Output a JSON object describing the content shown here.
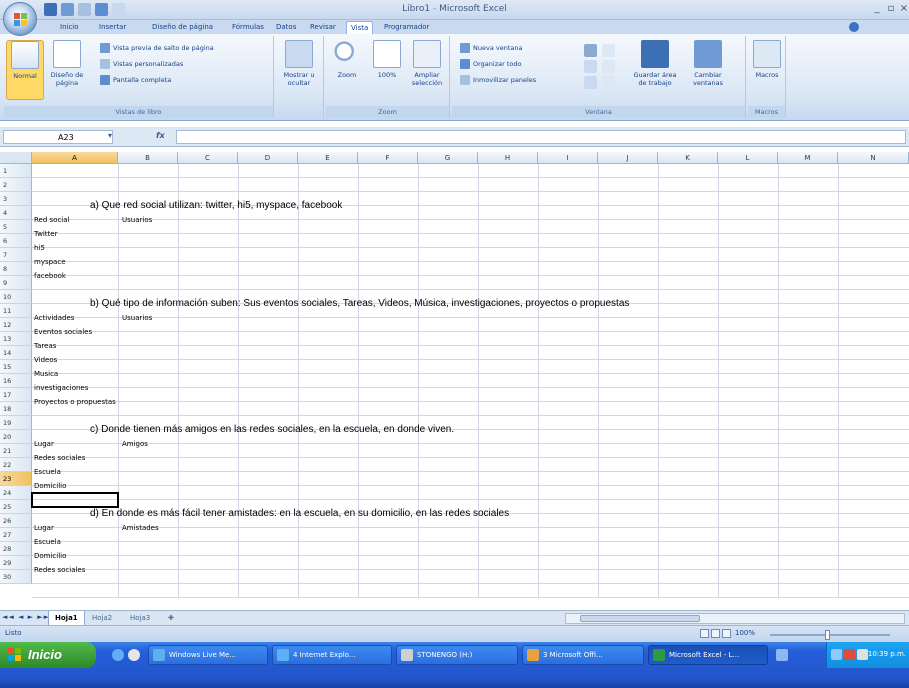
{
  "window": {
    "title_doc": "Libro1",
    "title_sep": "-",
    "title_app": "Microsoft Excel"
  },
  "ribbon_tabs": [
    "Inicio",
    "Insertar",
    "Diseño de página",
    "Fórmulas",
    "Datos",
    "Revisar",
    "Vista",
    "Programador"
  ],
  "active_tab": "Vista",
  "ribbon": {
    "vistas_libro": {
      "label": "Vistas de libro",
      "normal": "Normal",
      "diseno_pagina": "Diseño de página",
      "vista_previa": "Vista previa de salto de página",
      "vistas_personalizadas": "Vistas personalizadas",
      "pantalla_completa": "Pantalla completa"
    },
    "mostrar": {
      "label": "Mostrar u ocultar"
    },
    "zoom": {
      "label": "Zoom",
      "zoom": "Zoom",
      "cien": "100%",
      "ampliar": "Ampliar selección"
    },
    "ventana": {
      "label": "Ventana",
      "nueva": "Nueva ventana",
      "organizar": "Organizar todo",
      "inmovilizar": "Inmovilizar paneles",
      "guardar_area": "Guardar área de trabajo",
      "cambiar": "Cambiar ventanas"
    },
    "macros": {
      "label": "Macros",
      "macros": "Macros"
    }
  },
  "formula_bar": {
    "name_box": "A23",
    "fx": "fx",
    "value": ""
  },
  "columns": [
    "A",
    "B",
    "C",
    "D",
    "E",
    "F",
    "G",
    "H",
    "I",
    "J",
    "K",
    "L",
    "M",
    "N"
  ],
  "rows": [
    "1",
    "2",
    "3",
    "4",
    "5",
    "6",
    "7",
    "8",
    "9",
    "10",
    "11",
    "12",
    "13",
    "14",
    "15",
    "16",
    "17",
    "18",
    "19",
    "20",
    "21",
    "22",
    "23",
    "24",
    "25",
    "26",
    "27",
    "28",
    "29",
    "30"
  ],
  "selected_cell": "A23",
  "sheet_content": {
    "q_a": "a) Que red social utilizan:  twitter, hi5,  myspace,  facebook",
    "a_col_a": [
      "Red social",
      "Twitter",
      "hi5",
      "myspace",
      "facebook"
    ],
    "a_col_b": "Usuarios",
    "q_b": "b)  Qué tipo de información suben: Sus eventos sociales, Tareas, Videos, Música, investigaciones, proyectos o propuestas",
    "b_col_a": [
      "Actividades",
      "Eventos sociales",
      "Tareas",
      "Videos",
      "Musica",
      "investigaciones",
      "Proyectos o propuestas"
    ],
    "b_col_b": "Usuarios",
    "q_c": "c)  Donde tienen más amigos  en las redes sociales, en la escuela, en donde viven.",
    "c_col_a": [
      "Lugar",
      "Redes sociales",
      "Escuela",
      "Domicilio"
    ],
    "c_col_b": "Amigos",
    "q_d": "d)  En donde es más fácil tener amistades: en la escuela, en su domicilio, en las redes sociales",
    "d_col_a": [
      "Lugar",
      "Escuela",
      "Domicilio",
      "Redes sociales"
    ],
    "d_col_b": "Amistades"
  },
  "sheets": [
    "Hoja1",
    "Hoja2",
    "Hoja3"
  ],
  "active_sheet": "Hoja1",
  "status": {
    "mode": "Listo",
    "zoom": "100%"
  },
  "taskbar": {
    "start": "Inicio",
    "items": [
      "Windows Live Me...",
      "4 Internet Explo...",
      "STONENGO (H:)",
      "3 Microsoft Offi...",
      "Microsoft Excel - L..."
    ],
    "active_index": 4,
    "clock": "10:39 p.m."
  }
}
